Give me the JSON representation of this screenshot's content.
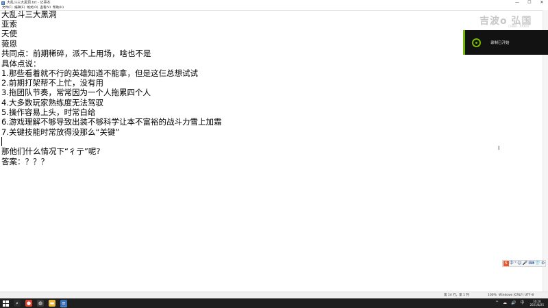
{
  "window": {
    "title": "大乱斗三大黑洞.txt - 记事本",
    "controls": {
      "minimize": "—",
      "maximize": "☐",
      "close": "✕"
    }
  },
  "menu": [
    "文件(F)",
    "编辑(E)",
    "格式(O)",
    "查看(V)",
    "帮助(H)"
  ],
  "document": {
    "lines": [
      "大乱斗三大黑洞",
      "亚索",
      "天使",
      "薇恩",
      "共同点：前期稀碎，派不上用场，啥也不是",
      "具体点说：",
      "1.那些看着就不行的英雄知道不能拿，但是这仨总想试试",
      "2.前期打架帮不上忙，没有用",
      "3.拖团队节奏，常常因为一个人拖累四个人",
      "4.大多数玩家熟练度无法驾驭",
      "5.操作容易上头，时常白给",
      "6.游戏理解不够导致出装不够科学让本不富裕的战斗力雪上加霜",
      "7.关键技能时常放得没那么“关键”",
      "",
      "那他们什么情况下“彳亍”呢?",
      "答案：？？？"
    ]
  },
  "watermark": {
    "text": "吉波o 弘国",
    "sub": "CHINA · XXXXX"
  },
  "notification": {
    "text": "录制已开始",
    "icon": "record-icon",
    "accent": "#76b900"
  },
  "statusbar": {
    "position": "第 14 行，第 1 列",
    "zoom": "100%",
    "line_ending": "Windows (CRLF)",
    "encoding": "UTF-8"
  },
  "ime_toolbar": {
    "logo": "S",
    "items": [
      "中",
      "°",
      "☺",
      "🎤",
      "⌨",
      "👕",
      "⚙"
    ]
  },
  "taskbar": {
    "apps": [
      "search-icon",
      "browser-icon",
      "folder-icon",
      "edge-icon",
      "notepad-icon"
    ],
    "tray": [
      "^",
      "☁",
      "🔊",
      "中"
    ],
    "time": "16:20",
    "date": "2021/8/25"
  }
}
